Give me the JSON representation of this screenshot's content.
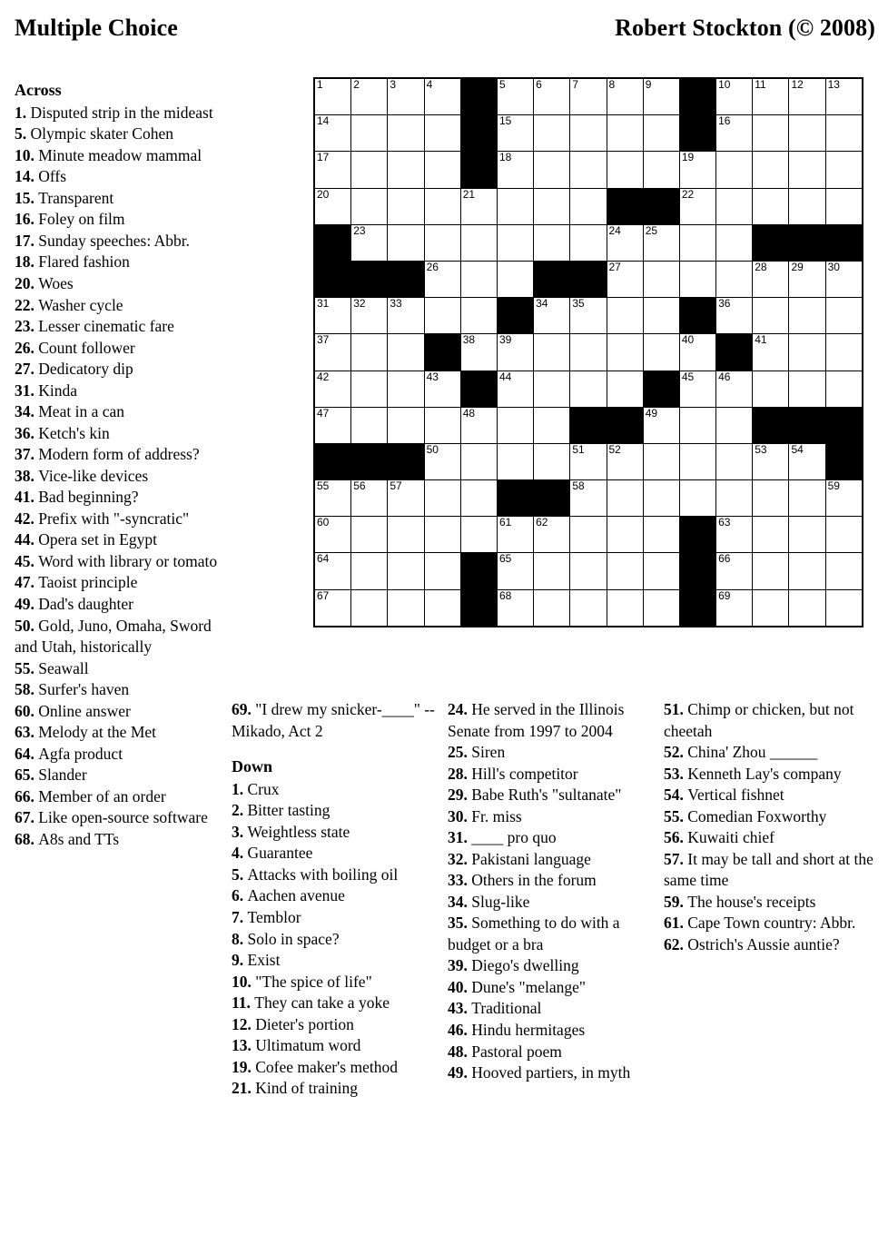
{
  "header": {
    "title": "Multiple Choice",
    "author": "Robert Stockton (© 2008)"
  },
  "labels": {
    "across_heading": "Across",
    "down_heading": "Down"
  },
  "grid": {
    "rows": 15,
    "cols": 15,
    "block_color": "#000000",
    "cell_color": "#ffffff",
    "cells": [
      [
        {
          "b": 0,
          "n": "1"
        },
        {
          "b": 0,
          "n": "2"
        },
        {
          "b": 0,
          "n": "3"
        },
        {
          "b": 0,
          "n": "4"
        },
        {
          "b": 1,
          "n": ""
        },
        {
          "b": 0,
          "n": "5"
        },
        {
          "b": 0,
          "n": "6"
        },
        {
          "b": 0,
          "n": "7"
        },
        {
          "b": 0,
          "n": "8"
        },
        {
          "b": 0,
          "n": "9"
        },
        {
          "b": 1,
          "n": ""
        },
        {
          "b": 0,
          "n": "10"
        },
        {
          "b": 0,
          "n": "11"
        },
        {
          "b": 0,
          "n": "12"
        },
        {
          "b": 0,
          "n": "13"
        }
      ],
      [
        {
          "b": 0,
          "n": "14"
        },
        {
          "b": 0,
          "n": ""
        },
        {
          "b": 0,
          "n": ""
        },
        {
          "b": 0,
          "n": ""
        },
        {
          "b": 1,
          "n": ""
        },
        {
          "b": 0,
          "n": "15"
        },
        {
          "b": 0,
          "n": ""
        },
        {
          "b": 0,
          "n": ""
        },
        {
          "b": 0,
          "n": ""
        },
        {
          "b": 0,
          "n": ""
        },
        {
          "b": 1,
          "n": ""
        },
        {
          "b": 0,
          "n": "16"
        },
        {
          "b": 0,
          "n": ""
        },
        {
          "b": 0,
          "n": ""
        },
        {
          "b": 0,
          "n": ""
        }
      ],
      [
        {
          "b": 0,
          "n": "17"
        },
        {
          "b": 0,
          "n": ""
        },
        {
          "b": 0,
          "n": ""
        },
        {
          "b": 0,
          "n": ""
        },
        {
          "b": 1,
          "n": ""
        },
        {
          "b": 0,
          "n": "18"
        },
        {
          "b": 0,
          "n": ""
        },
        {
          "b": 0,
          "n": ""
        },
        {
          "b": 0,
          "n": ""
        },
        {
          "b": 0,
          "n": ""
        },
        {
          "b": 0,
          "n": "19"
        },
        {
          "b": 0,
          "n": ""
        },
        {
          "b": 0,
          "n": ""
        },
        {
          "b": 0,
          "n": ""
        },
        {
          "b": 0,
          "n": ""
        }
      ],
      [
        {
          "b": 0,
          "n": "20"
        },
        {
          "b": 0,
          "n": ""
        },
        {
          "b": 0,
          "n": ""
        },
        {
          "b": 0,
          "n": ""
        },
        {
          "b": 0,
          "n": "21"
        },
        {
          "b": 0,
          "n": ""
        },
        {
          "b": 0,
          "n": ""
        },
        {
          "b": 0,
          "n": ""
        },
        {
          "b": 1,
          "n": ""
        },
        {
          "b": 1,
          "n": ""
        },
        {
          "b": 0,
          "n": "22"
        },
        {
          "b": 0,
          "n": ""
        },
        {
          "b": 0,
          "n": ""
        },
        {
          "b": 0,
          "n": ""
        },
        {
          "b": 0,
          "n": ""
        }
      ],
      [
        {
          "b": 1,
          "n": ""
        },
        {
          "b": 0,
          "n": "23"
        },
        {
          "b": 0,
          "n": ""
        },
        {
          "b": 0,
          "n": ""
        },
        {
          "b": 0,
          "n": ""
        },
        {
          "b": 0,
          "n": ""
        },
        {
          "b": 0,
          "n": ""
        },
        {
          "b": 0,
          "n": ""
        },
        {
          "b": 0,
          "n": "24"
        },
        {
          "b": 0,
          "n": "25"
        },
        {
          "b": 0,
          "n": ""
        },
        {
          "b": 0,
          "n": ""
        },
        {
          "b": 1,
          "n": ""
        },
        {
          "b": 1,
          "n": ""
        },
        {
          "b": 1,
          "n": ""
        }
      ],
      [
        {
          "b": 1,
          "n": ""
        },
        {
          "b": 1,
          "n": ""
        },
        {
          "b": 1,
          "n": ""
        },
        {
          "b": 0,
          "n": "26"
        },
        {
          "b": 0,
          "n": ""
        },
        {
          "b": 0,
          "n": ""
        },
        {
          "b": 1,
          "n": ""
        },
        {
          "b": 1,
          "n": ""
        },
        {
          "b": 0,
          "n": "27"
        },
        {
          "b": 0,
          "n": ""
        },
        {
          "b": 0,
          "n": ""
        },
        {
          "b": 0,
          "n": ""
        },
        {
          "b": 0,
          "n": "28"
        },
        {
          "b": 0,
          "n": "29"
        },
        {
          "b": 0,
          "n": "30"
        }
      ],
      [
        {
          "b": 0,
          "n": "31"
        },
        {
          "b": 0,
          "n": "32"
        },
        {
          "b": 0,
          "n": "33"
        },
        {
          "b": 0,
          "n": ""
        },
        {
          "b": 0,
          "n": ""
        },
        {
          "b": 1,
          "n": ""
        },
        {
          "b": 0,
          "n": "34"
        },
        {
          "b": 0,
          "n": "35"
        },
        {
          "b": 0,
          "n": ""
        },
        {
          "b": 0,
          "n": ""
        },
        {
          "b": 1,
          "n": ""
        },
        {
          "b": 0,
          "n": "36"
        },
        {
          "b": 0,
          "n": ""
        },
        {
          "b": 0,
          "n": ""
        },
        {
          "b": 0,
          "n": ""
        }
      ],
      [
        {
          "b": 0,
          "n": "37"
        },
        {
          "b": 0,
          "n": ""
        },
        {
          "b": 0,
          "n": ""
        },
        {
          "b": 1,
          "n": ""
        },
        {
          "b": 0,
          "n": "38"
        },
        {
          "b": 0,
          "n": "39"
        },
        {
          "b": 0,
          "n": ""
        },
        {
          "b": 0,
          "n": ""
        },
        {
          "b": 0,
          "n": ""
        },
        {
          "b": 0,
          "n": ""
        },
        {
          "b": 0,
          "n": "40"
        },
        {
          "b": 1,
          "n": ""
        },
        {
          "b": 0,
          "n": "41"
        },
        {
          "b": 0,
          "n": ""
        },
        {
          "b": 0,
          "n": ""
        }
      ],
      [
        {
          "b": 0,
          "n": "42"
        },
        {
          "b": 0,
          "n": ""
        },
        {
          "b": 0,
          "n": ""
        },
        {
          "b": 0,
          "n": "43"
        },
        {
          "b": 1,
          "n": ""
        },
        {
          "b": 0,
          "n": "44"
        },
        {
          "b": 0,
          "n": ""
        },
        {
          "b": 0,
          "n": ""
        },
        {
          "b": 0,
          "n": ""
        },
        {
          "b": 1,
          "n": ""
        },
        {
          "b": 0,
          "n": "45"
        },
        {
          "b": 0,
          "n": "46"
        },
        {
          "b": 0,
          "n": ""
        },
        {
          "b": 0,
          "n": ""
        },
        {
          "b": 0,
          "n": ""
        }
      ],
      [
        {
          "b": 0,
          "n": "47"
        },
        {
          "b": 0,
          "n": ""
        },
        {
          "b": 0,
          "n": ""
        },
        {
          "b": 0,
          "n": ""
        },
        {
          "b": 0,
          "n": "48"
        },
        {
          "b": 0,
          "n": ""
        },
        {
          "b": 0,
          "n": ""
        },
        {
          "b": 1,
          "n": ""
        },
        {
          "b": 1,
          "n": ""
        },
        {
          "b": 0,
          "n": "49"
        },
        {
          "b": 0,
          "n": ""
        },
        {
          "b": 0,
          "n": ""
        },
        {
          "b": 1,
          "n": ""
        },
        {
          "b": 1,
          "n": ""
        },
        {
          "b": 1,
          "n": ""
        }
      ],
      [
        {
          "b": 1,
          "n": ""
        },
        {
          "b": 1,
          "n": ""
        },
        {
          "b": 1,
          "n": ""
        },
        {
          "b": 0,
          "n": "50"
        },
        {
          "b": 0,
          "n": ""
        },
        {
          "b": 0,
          "n": ""
        },
        {
          "b": 0,
          "n": ""
        },
        {
          "b": 0,
          "n": "51"
        },
        {
          "b": 0,
          "n": "52"
        },
        {
          "b": 0,
          "n": ""
        },
        {
          "b": 0,
          "n": ""
        },
        {
          "b": 0,
          "n": ""
        },
        {
          "b": 0,
          "n": "53"
        },
        {
          "b": 0,
          "n": "54"
        },
        {
          "b": 1,
          "n": ""
        }
      ],
      [
        {
          "b": 0,
          "n": "55"
        },
        {
          "b": 0,
          "n": "56"
        },
        {
          "b": 0,
          "n": "57"
        },
        {
          "b": 0,
          "n": ""
        },
        {
          "b": 0,
          "n": ""
        },
        {
          "b": 1,
          "n": ""
        },
        {
          "b": 1,
          "n": ""
        },
        {
          "b": 0,
          "n": "58"
        },
        {
          "b": 0,
          "n": ""
        },
        {
          "b": 0,
          "n": ""
        },
        {
          "b": 0,
          "n": ""
        },
        {
          "b": 0,
          "n": ""
        },
        {
          "b": 0,
          "n": ""
        },
        {
          "b": 0,
          "n": ""
        },
        {
          "b": 0,
          "n": "59"
        }
      ],
      [
        {
          "b": 0,
          "n": "60"
        },
        {
          "b": 0,
          "n": ""
        },
        {
          "b": 0,
          "n": ""
        },
        {
          "b": 0,
          "n": ""
        },
        {
          "b": 0,
          "n": ""
        },
        {
          "b": 0,
          "n": "61"
        },
        {
          "b": 0,
          "n": "62"
        },
        {
          "b": 0,
          "n": ""
        },
        {
          "b": 0,
          "n": ""
        },
        {
          "b": 0,
          "n": ""
        },
        {
          "b": 1,
          "n": ""
        },
        {
          "b": 0,
          "n": "63"
        },
        {
          "b": 0,
          "n": ""
        },
        {
          "b": 0,
          "n": ""
        },
        {
          "b": 0,
          "n": ""
        }
      ],
      [
        {
          "b": 0,
          "n": "64"
        },
        {
          "b": 0,
          "n": ""
        },
        {
          "b": 0,
          "n": ""
        },
        {
          "b": 0,
          "n": ""
        },
        {
          "b": 1,
          "n": ""
        },
        {
          "b": 0,
          "n": "65"
        },
        {
          "b": 0,
          "n": ""
        },
        {
          "b": 0,
          "n": ""
        },
        {
          "b": 0,
          "n": ""
        },
        {
          "b": 0,
          "n": ""
        },
        {
          "b": 1,
          "n": ""
        },
        {
          "b": 0,
          "n": "66"
        },
        {
          "b": 0,
          "n": ""
        },
        {
          "b": 0,
          "n": ""
        },
        {
          "b": 0,
          "n": ""
        }
      ],
      [
        {
          "b": 0,
          "n": "67"
        },
        {
          "b": 0,
          "n": ""
        },
        {
          "b": 0,
          "n": ""
        },
        {
          "b": 0,
          "n": ""
        },
        {
          "b": 1,
          "n": ""
        },
        {
          "b": 0,
          "n": "68"
        },
        {
          "b": 0,
          "n": ""
        },
        {
          "b": 0,
          "n": ""
        },
        {
          "b": 0,
          "n": ""
        },
        {
          "b": 0,
          "n": ""
        },
        {
          "b": 1,
          "n": ""
        },
        {
          "b": 0,
          "n": "69"
        },
        {
          "b": 0,
          "n": ""
        },
        {
          "b": 0,
          "n": ""
        },
        {
          "b": 0,
          "n": ""
        }
      ]
    ]
  },
  "across": [
    {
      "num": "1.",
      "text": "Disputed strip in the mideast"
    },
    {
      "num": "5.",
      "text": "Olympic skater Cohen"
    },
    {
      "num": "10.",
      "text": "Minute meadow mammal"
    },
    {
      "num": "14.",
      "text": "Offs"
    },
    {
      "num": "15.",
      "text": "Transparent"
    },
    {
      "num": "16.",
      "text": "Foley on film"
    },
    {
      "num": "17.",
      "text": "Sunday speeches: Abbr."
    },
    {
      "num": "18.",
      "text": "Flared fashion"
    },
    {
      "num": "20.",
      "text": "Woes"
    },
    {
      "num": "22.",
      "text": "Washer cycle"
    },
    {
      "num": "23.",
      "text": "Lesser cinematic fare"
    },
    {
      "num": "26.",
      "text": "Count follower"
    },
    {
      "num": "27.",
      "text": "Dedicatory dip"
    },
    {
      "num": "31.",
      "text": "Kinda"
    },
    {
      "num": "34.",
      "text": "Meat in a can"
    },
    {
      "num": "36.",
      "text": "Ketch's kin"
    },
    {
      "num": "37.",
      "text": "Modern form of address?"
    },
    {
      "num": "38.",
      "text": "Vice-like devices"
    },
    {
      "num": "41.",
      "text": "Bad beginning?"
    },
    {
      "num": "42.",
      "text": "Prefix with \"-syncratic\""
    },
    {
      "num": "44.",
      "text": "Opera set in Egypt"
    },
    {
      "num": "45.",
      "text": "Word with library or tomato"
    },
    {
      "num": "47.",
      "text": "Taoist principle"
    },
    {
      "num": "49.",
      "text": "Dad's daughter"
    },
    {
      "num": "50.",
      "text": "Gold, Juno, Omaha, Sword and Utah, historically"
    },
    {
      "num": "55.",
      "text": "Seawall"
    },
    {
      "num": "58.",
      "text": "Surfer's haven"
    },
    {
      "num": "60.",
      "text": "Online answer"
    },
    {
      "num": "63.",
      "text": "Melody at the Met"
    },
    {
      "num": "64.",
      "text": "Agfa product"
    },
    {
      "num": "65.",
      "text": "Slander"
    },
    {
      "num": "66.",
      "text": "Member of an order"
    },
    {
      "num": "67.",
      "text": "Like open-source software"
    },
    {
      "num": "68.",
      "text": "A8s and TTs"
    },
    {
      "num": "69.",
      "text": "\"I drew my snicker-____\" -- Mikado, Act 2"
    }
  ],
  "down": [
    {
      "num": "1.",
      "text": "Crux"
    },
    {
      "num": "2.",
      "text": "Bitter tasting"
    },
    {
      "num": "3.",
      "text": "Weightless state"
    },
    {
      "num": "4.",
      "text": "Guarantee"
    },
    {
      "num": "5.",
      "text": "Attacks with boiling oil"
    },
    {
      "num": "6.",
      "text": "Aachen avenue"
    },
    {
      "num": "7.",
      "text": "Temblor"
    },
    {
      "num": "8.",
      "text": "Solo in space?"
    },
    {
      "num": "9.",
      "text": "Exist"
    },
    {
      "num": "10.",
      "text": "\"The spice of life\""
    },
    {
      "num": "11.",
      "text": "They can take a yoke"
    },
    {
      "num": "12.",
      "text": "Dieter's portion"
    },
    {
      "num": "13.",
      "text": "Ultimatum word"
    },
    {
      "num": "19.",
      "text": "Cofee maker's method"
    },
    {
      "num": "21.",
      "text": "Kind of training"
    },
    {
      "num": "24.",
      "text": "He served in the Illinois Senate from 1997 to 2004"
    },
    {
      "num": "25.",
      "text": "Siren"
    },
    {
      "num": "28.",
      "text": "Hill's competitor"
    },
    {
      "num": "29.",
      "text": "Babe Ruth's \"sultanate\""
    },
    {
      "num": "30.",
      "text": "Fr. miss"
    },
    {
      "num": "31.",
      "text": "____ pro quo"
    },
    {
      "num": "32.",
      "text": "Pakistani language"
    },
    {
      "num": "33.",
      "text": "Others in the forum"
    },
    {
      "num": "34.",
      "text": "Slug-like"
    },
    {
      "num": "35.",
      "text": "Something to do with a budget or a bra"
    },
    {
      "num": "39.",
      "text": "Diego's dwelling"
    },
    {
      "num": "40.",
      "text": "Dune's \"melange\""
    },
    {
      "num": "43.",
      "text": "Traditional"
    },
    {
      "num": "46.",
      "text": "Hindu hermitages"
    },
    {
      "num": "48.",
      "text": "Pastoral poem"
    },
    {
      "num": "49.",
      "text": "Hooved partiers, in myth"
    },
    {
      "num": "51.",
      "text": "Chimp or chicken, but not cheetah"
    },
    {
      "num": "52.",
      "text": "China' Zhou ______"
    },
    {
      "num": "53.",
      "text": "Kenneth Lay's company"
    },
    {
      "num": "54.",
      "text": "Vertical fishnet"
    },
    {
      "num": "55.",
      "text": "Comedian Foxworthy"
    },
    {
      "num": "56.",
      "text": "Kuwaiti chief"
    },
    {
      "num": "57.",
      "text": "It may be tall and short at the same time"
    },
    {
      "num": "59.",
      "text": "The house's receipts"
    },
    {
      "num": "61.",
      "text": "Cape Town country: Abbr."
    },
    {
      "num": "62.",
      "text": "Ostrich's Aussie auntie?"
    }
  ],
  "layout": {
    "col_across_count": 34,
    "col2_across_start": 34,
    "col2_down_count": 15,
    "col3_down_start": 15,
    "col3_down_count": 16,
    "col4_down_start": 31
  }
}
